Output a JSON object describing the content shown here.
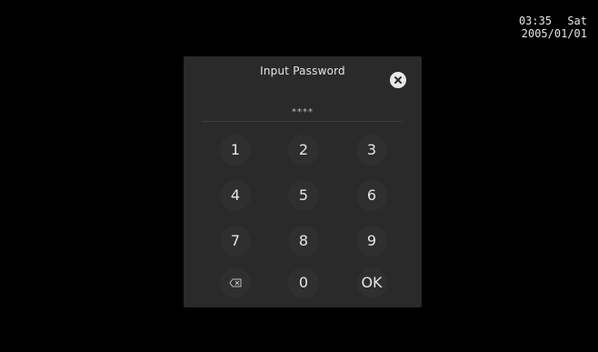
{
  "status": {
    "time": "03:35",
    "weekday": "Sat",
    "date": "2005/01/01"
  },
  "dialog": {
    "title": "Input Password",
    "masked_value": "****",
    "close_icon": "close-icon"
  },
  "keypad": {
    "keys": [
      "1",
      "2",
      "3",
      "4",
      "5",
      "6",
      "7",
      "8",
      "9"
    ],
    "zero": "0",
    "ok": "OK",
    "backspace_icon": "backspace-icon"
  },
  "colors": {
    "background": "#000000",
    "dialog": "#2a2a2a",
    "key": "#2f2f2f",
    "text": "#e6e6e6",
    "close_bg": "#e9e9e9"
  }
}
